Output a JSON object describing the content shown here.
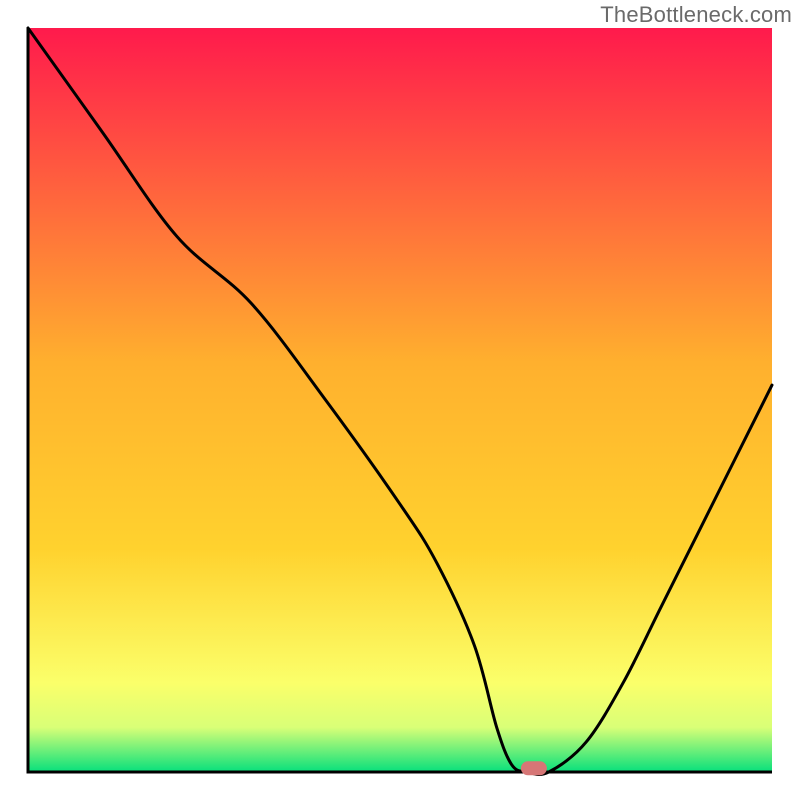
{
  "watermark": "TheBottleneck.com",
  "chart_data": {
    "type": "line",
    "title": "",
    "xlabel": "",
    "ylabel": "",
    "xlim": [
      0,
      100
    ],
    "ylim": [
      0,
      100
    ],
    "grid": false,
    "legend": false,
    "background_gradient": {
      "top_color": "#ff1a4c",
      "mid_color": "#ffd22e",
      "low_color": "#fbff6a",
      "bottom_band_color": "#07e07c"
    },
    "series": [
      {
        "name": "bottleneck-curve",
        "color": "#000000",
        "x": [
          0,
          10,
          20,
          30,
          40,
          50,
          55,
          60,
          63,
          65,
          67,
          70,
          75,
          80,
          85,
          90,
          95,
          100
        ],
        "y": [
          100,
          86,
          72,
          63,
          50,
          36,
          28,
          17,
          6,
          1,
          0,
          0,
          4,
          12,
          22,
          32,
          42,
          52
        ]
      }
    ],
    "marker": {
      "name": "optimal-point",
      "x": 68,
      "y": 0.5,
      "color": "#d67676",
      "shape": "rounded"
    }
  }
}
